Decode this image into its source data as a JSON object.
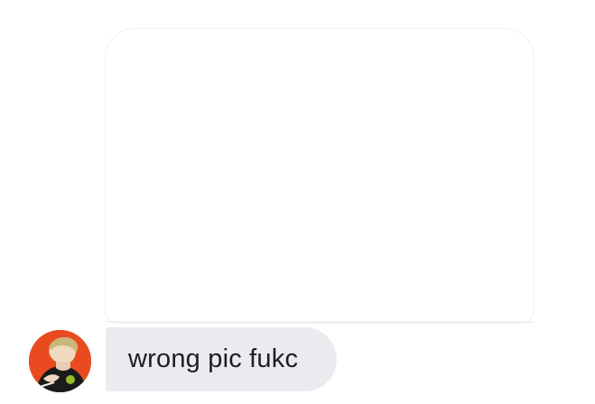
{
  "message": {
    "sender_avatar": "avatar-illustration",
    "text": "wrong pic fukc",
    "attached_image": "blank-image"
  },
  "colors": {
    "bubble_background": "#e9ebee",
    "text": "#1c1e21",
    "avatar_background": "#e94a20"
  }
}
